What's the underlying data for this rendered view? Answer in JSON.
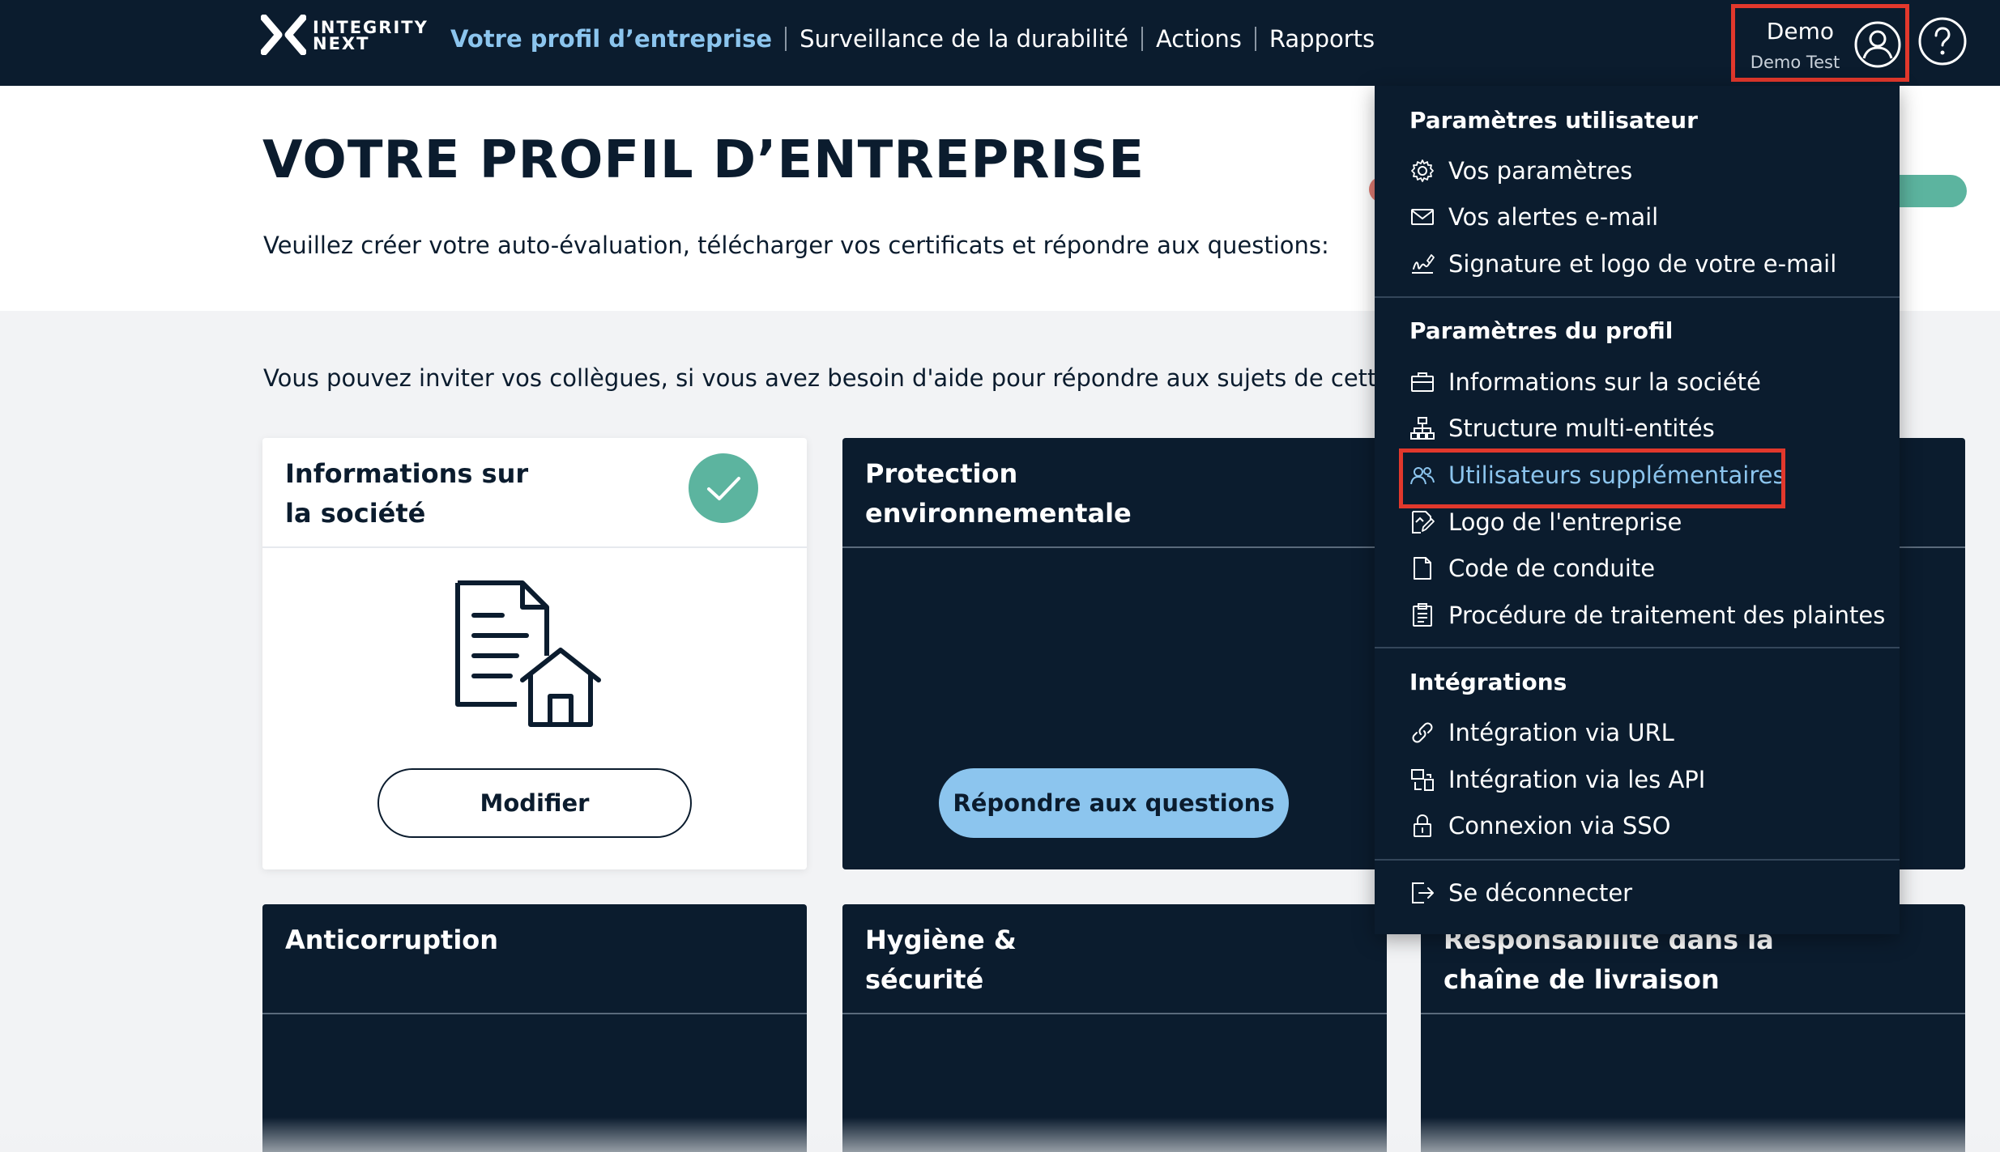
{
  "brand": {
    "line1": "INTEGRITY",
    "line2": "NEXT"
  },
  "nav": {
    "items": [
      {
        "label": "Votre profil d’entreprise",
        "active": true
      },
      {
        "label": "Surveillance de la durabilité",
        "active": false
      },
      {
        "label": "Actions",
        "active": false
      },
      {
        "label": "Rapports",
        "active": false
      }
    ]
  },
  "user": {
    "name": "Demo",
    "subtitle": "Demo Test"
  },
  "page": {
    "title": "VOTRE PROFIL D’ENTREPRISE",
    "intro": "Veuillez créer votre auto-évaluation, télécharger vos certificats et répondre aux questions:",
    "invite": "Vous pouvez inviter vos collègues, si vous avez besoin d'aide pour répondre aux sujets de cette éva"
  },
  "cards": {
    "company_info": {
      "title_line1": "Informations sur",
      "title_line2": "la société",
      "button": "Modifier"
    },
    "environment": {
      "title_line1": "Protection",
      "title_line2": "environnementale",
      "button": "Répondre aux questions"
    },
    "anticorruption": {
      "title_line1": "Anticorruption"
    },
    "health": {
      "title_line1": "Hygiène &",
      "title_line2": "sécurité"
    },
    "supply_chain": {
      "title_line1": "Responsabilité dans la",
      "title_line2": "chaîne de livraison"
    }
  },
  "dropdown": {
    "user_settings": {
      "heading": "Paramètres utilisateur",
      "items": [
        "Vos paramètres",
        "Vos alertes e-mail",
        "Signature et logo de votre e-mail"
      ]
    },
    "profile_settings": {
      "heading": "Paramètres du profil",
      "items": [
        "Informations sur la société",
        "Structure multi-entités",
        "Utilisateurs supplémentaires",
        "Logo de l'entreprise",
        "Code de conduite",
        "Procédure de traitement des plaintes"
      ]
    },
    "integrations": {
      "heading": "Intégrations",
      "items": [
        "Intégration via URL",
        "Intégration via les API",
        "Connexion via SSO"
      ]
    },
    "logout": "Se déconnecter"
  },
  "colors": {
    "navy": "#0b1c2e",
    "accent_blue": "#8cc5ee",
    "teal": "#5cb49f",
    "highlight_red": "#e2382c"
  },
  "icons": {
    "settings": "gear-icon",
    "alerts": "envelope-icon",
    "signature": "signature-icon",
    "company": "briefcase-icon",
    "structure": "hierarchy-icon",
    "users": "users-icon",
    "logo": "edit-image-icon",
    "conduct": "document-icon",
    "complaints": "clipboard-icon",
    "url": "link-icon",
    "api": "api-icon",
    "sso": "lock-icon",
    "logout": "logout-icon"
  }
}
